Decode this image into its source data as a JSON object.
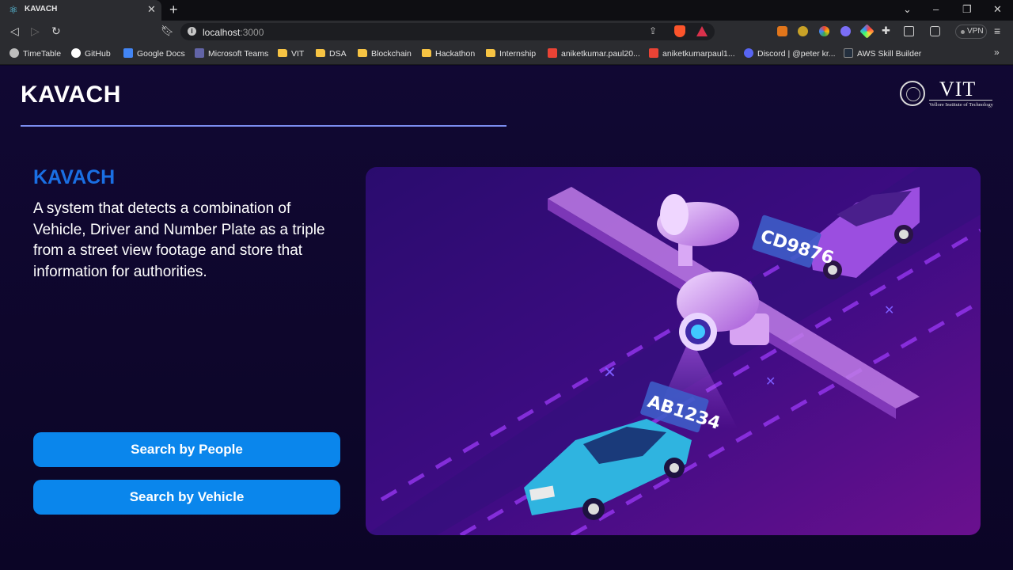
{
  "browser": {
    "tab": {
      "title": "KAVACH",
      "favicon": "react-icon"
    },
    "url": {
      "host": "localhost",
      "port": ":3000"
    },
    "vpn_label": "VPN",
    "bookmarks": [
      {
        "label": "TimeTable",
        "icon": "globe-icon"
      },
      {
        "label": "GitHub",
        "icon": "github-icon"
      },
      {
        "label": "Google Docs",
        "icon": "docs-icon"
      },
      {
        "label": "Microsoft Teams",
        "icon": "teams-icon"
      },
      {
        "label": "VIT",
        "icon": "folder-icon"
      },
      {
        "label": "DSA",
        "icon": "folder-icon"
      },
      {
        "label": "Blockchain",
        "icon": "folder-icon"
      },
      {
        "label": "Hackathon",
        "icon": "folder-icon"
      },
      {
        "label": "Internship",
        "icon": "folder-icon"
      },
      {
        "label": "aniketkumar.paul20...",
        "icon": "gmail-icon"
      },
      {
        "label": "aniketkumarpaul1...",
        "icon": "gmail-icon"
      },
      {
        "label": "Discord | @peter kr...",
        "icon": "discord-icon"
      },
      {
        "label": "AWS Skill Builder",
        "icon": "aws-icon"
      }
    ],
    "bookmarks_more": "»"
  },
  "header": {
    "brand": "KAVACH",
    "logo": {
      "text": "VIT",
      "subtitle": "Vellore Institute of Technology",
      "seal_text": "VIT"
    }
  },
  "hero": {
    "title": "KAVACH",
    "description": "A system that detects a combination of Vehicle, Driver and Number Plate as a triple from a street view footage and store that information for authorities."
  },
  "actions": {
    "search_people": "Search by People",
    "search_vehicle": "Search by Vehicle"
  },
  "illustration": {
    "plate_top": "CD9876",
    "plate_bottom": "AB1234",
    "colors": {
      "bg_from": "#2a0c6e",
      "bg_to": "#6a108e",
      "car_top": "#9b4ee0",
      "car_bottom": "#2fb4e0"
    }
  },
  "colors": {
    "accent": "#1a6fe3",
    "button": "#0a86ec",
    "rule": "#7b8df0",
    "page_bg": "#0c0627"
  }
}
